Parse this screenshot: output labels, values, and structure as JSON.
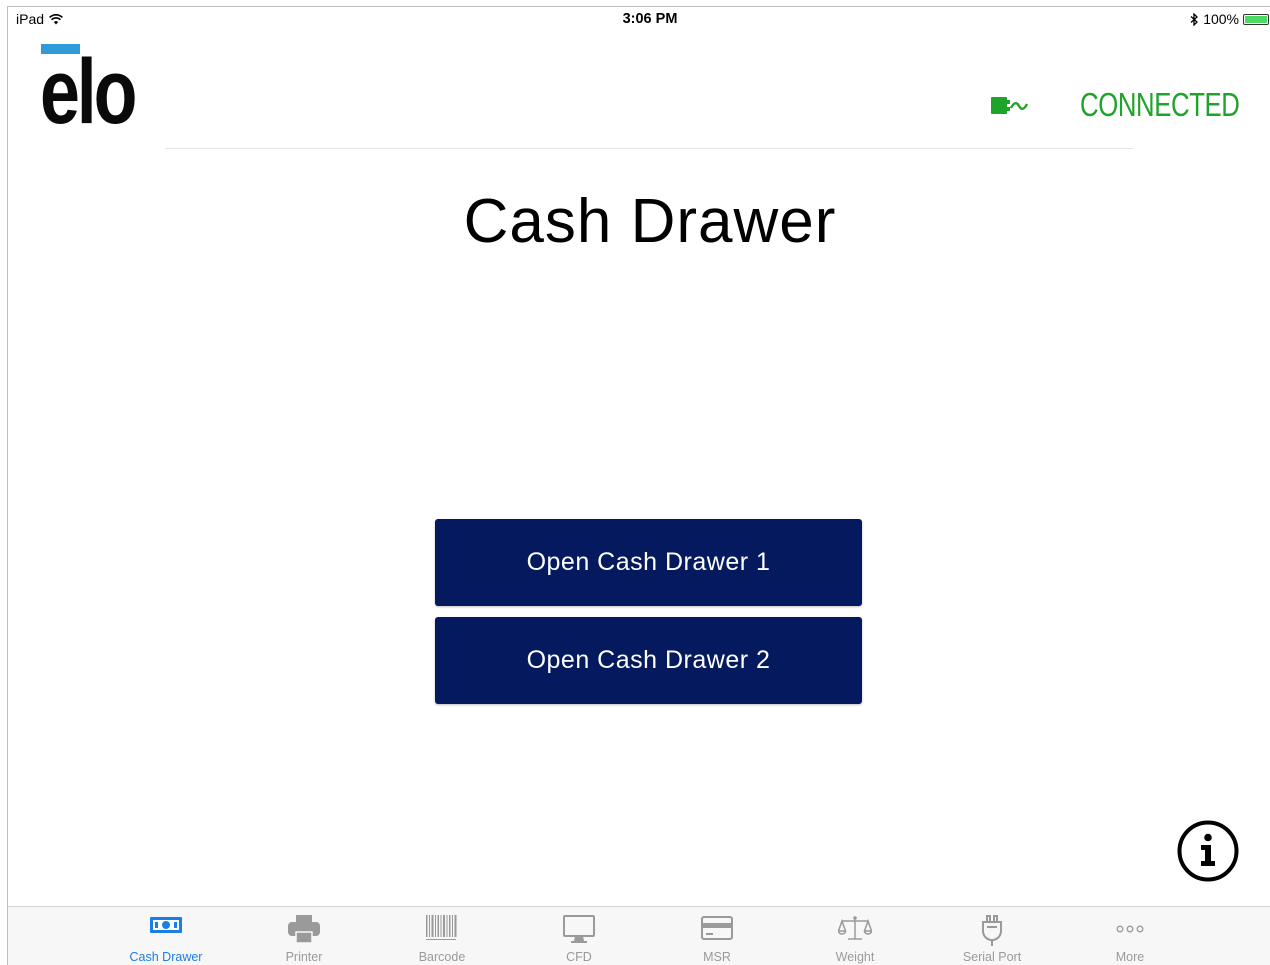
{
  "status_bar": {
    "device": "iPad",
    "time": "3:06 PM",
    "battery": "100%",
    "battery_level": 1.0,
    "battery_color": "#4cd964"
  },
  "header": {
    "logo_text": "elo",
    "logo_accent_color": "#2f9bd8",
    "connection_status": "CONNECTED",
    "connection_color": "#1fa32b"
  },
  "main": {
    "title": "Cash Drawer",
    "button_color": "#051a5e",
    "buttons": [
      {
        "label": "Open Cash Drawer 1"
      },
      {
        "label": "Open Cash Drawer 2"
      }
    ],
    "info_icon": "info-circle-icon"
  },
  "tabbar": {
    "active_color": "#1a7ee6",
    "inactive_color": "#9a9a9a",
    "tabs": [
      {
        "label": "Cash Drawer",
        "icon": "cash-drawer-icon",
        "active": true
      },
      {
        "label": "Printer",
        "icon": "printer-icon",
        "active": false
      },
      {
        "label": "Barcode",
        "icon": "barcode-icon",
        "active": false
      },
      {
        "label": "CFD",
        "icon": "monitor-icon",
        "active": false
      },
      {
        "label": "MSR",
        "icon": "card-icon",
        "active": false
      },
      {
        "label": "Weight",
        "icon": "scale-icon",
        "active": false
      },
      {
        "label": "Serial Port",
        "icon": "plug-icon",
        "active": false
      },
      {
        "label": "More",
        "icon": "more-icon",
        "active": false
      }
    ]
  }
}
